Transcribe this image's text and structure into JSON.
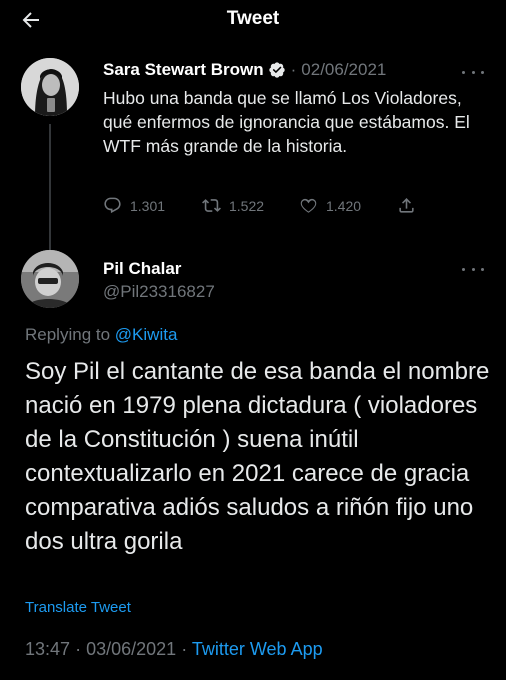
{
  "header": {
    "title": "Tweet",
    "back_icon": "arrow-left-icon"
  },
  "parent_tweet": {
    "author_name": "Sara Stewart Brown",
    "verified": true,
    "separator": "·",
    "date": "02/06/2021",
    "text": "Hubo una banda que se llamó Los Violadores, qué enfermos de ignorancia que estábamos. El WTF más grande de la historia.",
    "replies": "1.301",
    "retweets": "1.522",
    "likes": "1.420",
    "icons": [
      "reply-icon",
      "retweet-icon",
      "like-icon",
      "share-icon"
    ]
  },
  "main_tweet": {
    "author_name": "Pil Chalar",
    "handle": "@Pil23316827",
    "replying_prefix": "Replying to",
    "replying_to": "@Kiwita",
    "text": "Soy Pil el cantante de esa banda el nombre nació en 1979 plena dictadura ( violadores de la Constitución ) suena inútil contextualizarlo en 2021 carece de gracia comparativa  adiós saludos a riñón fijo uno dos ultra gorila",
    "translate_label": "Translate Tweet",
    "time": "13:47",
    "separator": "·",
    "date": "03/06/2021",
    "app": "Twitter Web App"
  },
  "colors": {
    "background": "#000000",
    "text": "#e7e9ea",
    "muted": "#71767b",
    "accent": "#1d9bf0"
  }
}
